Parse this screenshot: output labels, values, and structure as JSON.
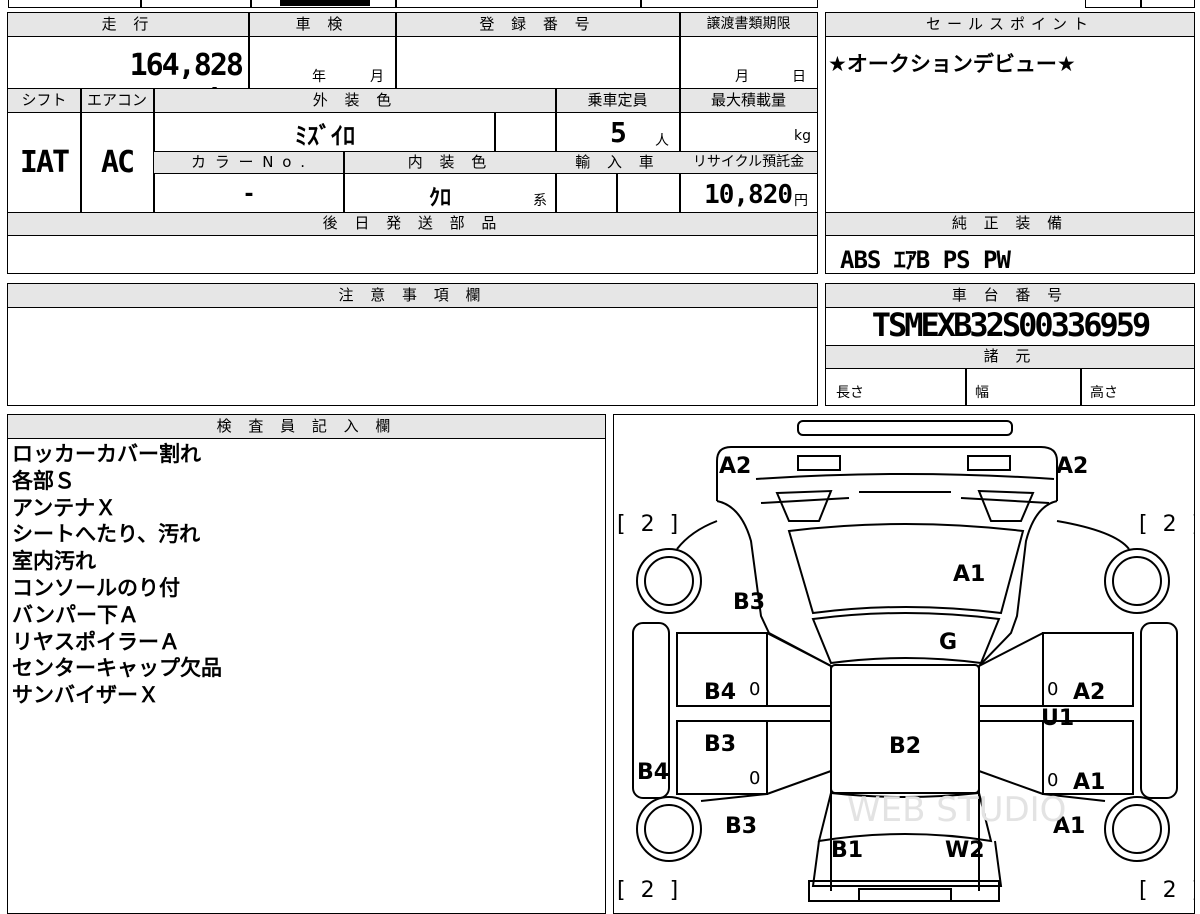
{
  "vehicle": {
    "mileage_label": "走 行",
    "mileage_value": "164,828 km",
    "inspection_label": "車 検",
    "inspection_year": "年",
    "inspection_month": "月",
    "reg_number_label": "登 録 番 号",
    "transfer_deadline_label": "譲渡書類期限",
    "transfer_month": "月",
    "transfer_day": "日",
    "shift_label": "シフト",
    "shift_value": "IAT",
    "aircon_label": "エアコン",
    "aircon_value": "AC",
    "ext_color_label": "外 装 色",
    "ext_color_value": "ﾐｽﾞｲﾛ",
    "capacity_label": "乗車定員",
    "capacity_value": "5",
    "capacity_unit": "人",
    "max_load_label": "最大積載量",
    "max_load_unit": "kg",
    "color_no_label": "カ ラ ー N o .",
    "color_no_value": "-",
    "int_color_label": "内 装 色",
    "int_color_value": "ｸﾛ",
    "int_color_suffix": "系",
    "import_label": "輸 入 車",
    "recycle_label": "リサイクル預託金",
    "recycle_value": "10,820",
    "recycle_unit": "円"
  },
  "sales_point": {
    "label": "セールスポイント",
    "text": "★オークションデビュー★"
  },
  "later_parts": {
    "label": "後 日 発 送 部 品"
  },
  "equipment": {
    "label": "純 正 装 備",
    "value": "ABS ｴｱB PS PW"
  },
  "notes": {
    "label": "注 意 事 項 欄"
  },
  "chassis": {
    "label": "車 台 番 号",
    "value": "TSMEXB32S00336959"
  },
  "specs": {
    "label": "諸 元",
    "length": "長さ",
    "width": "幅",
    "height": "高さ"
  },
  "inspector": {
    "label": "検 査 員 記 入 欄",
    "lines": [
      "ロッカーカバー割れ",
      "各部Ｓ",
      "アンテナＸ",
      "シートへたり、汚れ",
      "室内汚れ",
      "コンソールのり付",
      "バンパー下Ａ",
      "リヤスポイラーＡ",
      "センターキャップ欠品",
      "サンバイザーＸ"
    ]
  },
  "diagram": {
    "tag_2": "[ 2 ]",
    "a2_front_left": "A2",
    "a2_front_right": "A2",
    "a1_hood": "A1",
    "b3_left_front": "B3",
    "g_windshield": "G",
    "b4_left_front_door": "B4",
    "zero_1": "0",
    "b3_left_rear_door": "B3",
    "zero_2": "0",
    "b4_left_side": "B4",
    "b2_roof": "B2",
    "zero_3": "0",
    "a2_right_front_door": "A2",
    "u1_right": "U1",
    "zero_4": "0",
    "a1_right_rear_door": "A1",
    "b3_left_rear": "B3",
    "a1_right_rear": "A1",
    "b1_rear_left": "B1",
    "w2_rear_right": "W2",
    "watermark": "WEB STUDIO"
  }
}
